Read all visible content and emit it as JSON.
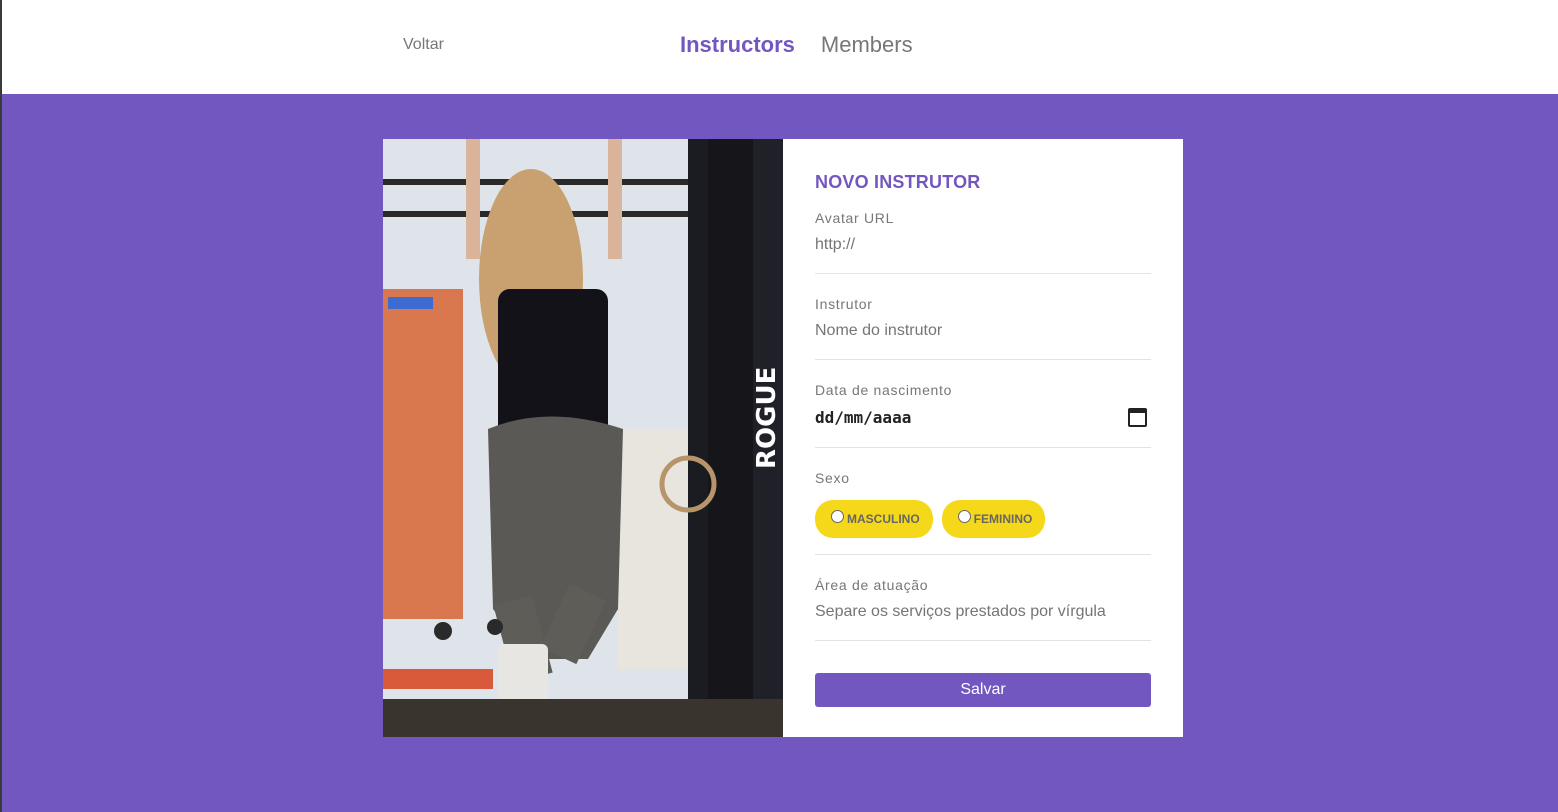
{
  "header": {
    "back_label": "Voltar",
    "nav": [
      {
        "label": "Instructors",
        "active": true
      },
      {
        "label": "Members",
        "active": false
      }
    ]
  },
  "form": {
    "title": "NOVO INSTRUTOR",
    "avatar": {
      "label": "Avatar URL",
      "placeholder": "http://"
    },
    "name": {
      "label": "Instrutor",
      "placeholder": "Nome do instrutor"
    },
    "birth": {
      "label": "Data de nascimento",
      "placeholder": "dd/mm/aaaa"
    },
    "gender": {
      "label": "Sexo",
      "options": [
        "MASCULINO",
        "FEMININO"
      ]
    },
    "services": {
      "label": "Área de atuação",
      "placeholder": "Separe os serviços prestados por vírgula"
    },
    "submit_label": "Salvar"
  },
  "photo": {
    "sign_text": "ROGUE"
  },
  "colors": {
    "accent": "#7357c0",
    "pill": "#f5d819",
    "text_muted": "#777777"
  }
}
